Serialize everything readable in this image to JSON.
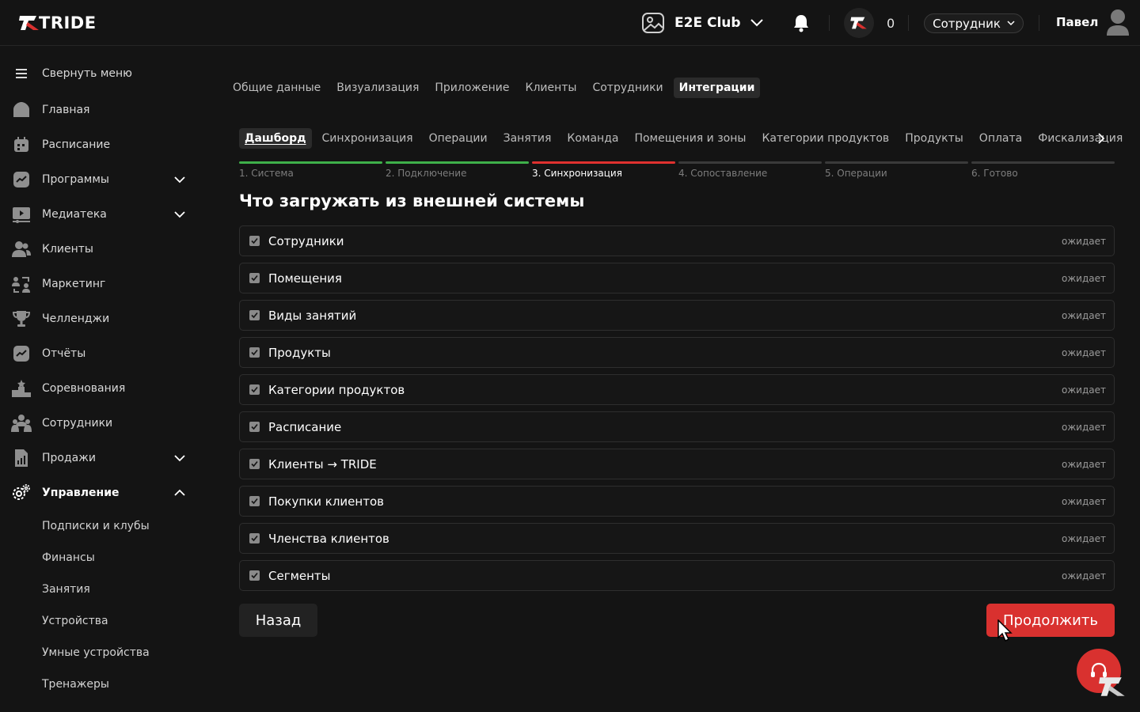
{
  "brand": {
    "name": "TRIDE",
    "accent": "#d9312f"
  },
  "header": {
    "club_name": "E2E Club",
    "coins": "0",
    "role": "Сотрудник",
    "user_name": "Павел"
  },
  "sidebar": {
    "collapse_label": "Свернуть меню",
    "items": [
      {
        "label": "Главная",
        "icon": "home-icon"
      },
      {
        "label": "Расписание",
        "icon": "calendar-icon"
      },
      {
        "label": "Программы",
        "icon": "chart-icon"
      },
      {
        "label": "Медиатека",
        "icon": "media-icon"
      },
      {
        "label": "Клиенты",
        "icon": "clients-icon"
      },
      {
        "label": "Маркетинг",
        "icon": "marketing-icon"
      },
      {
        "label": "Челленджи",
        "icon": "trophy-icon"
      },
      {
        "label": "Отчёты",
        "icon": "report-icon"
      },
      {
        "label": "Соревнования",
        "icon": "podium-icon"
      },
      {
        "label": "Сотрудники",
        "icon": "staff-icon"
      },
      {
        "label": "Продажи",
        "icon": "sales-icon"
      },
      {
        "label": "Управление",
        "icon": "gear-icon"
      }
    ],
    "subitems": [
      "Подписки и клубы",
      "Финансы",
      "Занятия",
      "Устройства",
      "Умные устройства",
      "Тренажеры"
    ]
  },
  "tabs_main": [
    "Общие данные",
    "Визуализация",
    "Приложение",
    "Клиенты",
    "Сотрудники",
    "Интеграции"
  ],
  "tabs_integrations": [
    "Дашборд",
    "Синхронизация",
    "Операции",
    "Занятия",
    "Команда",
    "Помещения и зоны",
    "Категории продуктов",
    "Продукты",
    "Оплата",
    "Фискализация"
  ],
  "steps": [
    "1. Система",
    "2. Подключение",
    "3. Синхронизация",
    "4. Сопоставление",
    "5. Операции",
    "6. Готово"
  ],
  "steps_completed": 2,
  "page_title": "Что загружать из внешней системы",
  "sync_items": [
    {
      "label": "Сотрудники",
      "status": "ожидает"
    },
    {
      "label": "Помещения",
      "status": "ожидает"
    },
    {
      "label": "Виды занятий",
      "status": "ожидает"
    },
    {
      "label": "Продукты",
      "status": "ожидает"
    },
    {
      "label": "Категории продуктов",
      "status": "ожидает"
    },
    {
      "label": "Расписание",
      "status": "ожидает"
    },
    {
      "label": "Клиенты → TRIDE",
      "status": "ожидает"
    },
    {
      "label": "Покупки клиентов",
      "status": "ожидает"
    },
    {
      "label": "Членства клиентов",
      "status": "ожидает"
    },
    {
      "label": "Сегменты",
      "status": "ожидает"
    }
  ],
  "buttons": {
    "back": "Назад",
    "next": "Продолжить"
  }
}
